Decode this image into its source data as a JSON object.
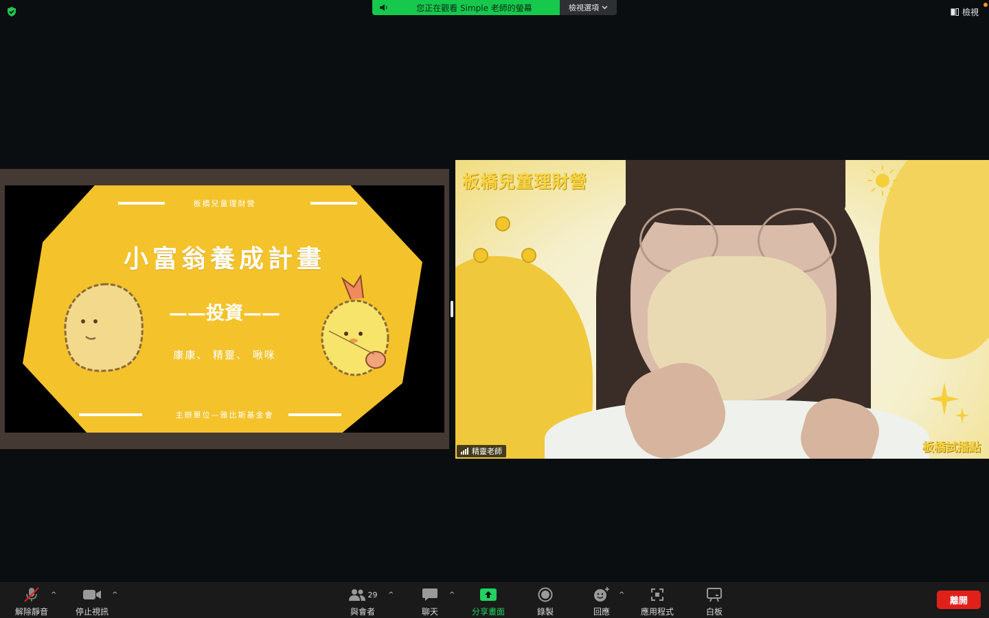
{
  "top": {
    "share_notice": "您正在觀看 Simple 老師的螢幕",
    "view_options": "檢視選項",
    "view_button": "檢視"
  },
  "slide": {
    "small_title": "板橋兒童理財營",
    "big_title": "小富翁養成計畫",
    "subtitle": "——投資——",
    "names": "康康、 精靈、 啾咪",
    "footer": "主辦單位—雅比斯基金會"
  },
  "video": {
    "bg_title": "板橋兒童理財營",
    "bg_corner": "板橋試播點",
    "participant_name": "精靈老師"
  },
  "toolbar": {
    "unmute": "解除靜音",
    "stop_video": "停止視訊",
    "participants": "與會者",
    "participant_count": "29",
    "chat": "聊天",
    "share_screen": "分享畫面",
    "record": "錄製",
    "reactions": "回應",
    "apps": "應用程式",
    "whiteboard": "白板",
    "leave": "離開"
  },
  "colors": {
    "share_green": "#16c94d",
    "slide_yellow": "#f4c22b",
    "leave_red": "#e0211a",
    "background": "#0b0e11"
  }
}
